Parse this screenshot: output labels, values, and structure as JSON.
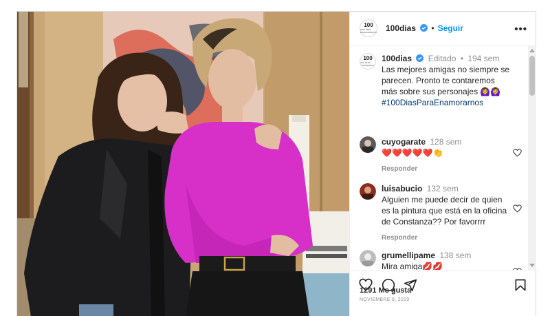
{
  "header": {
    "logo_text": "100",
    "logo_sub": "DÍAS PARA ENAMORARNOS",
    "username": "100dias",
    "separator": "•",
    "follow_label": "Seguir",
    "more_label": "•••"
  },
  "caption": {
    "username": "100dias",
    "edited": "Editado",
    "separator": "•",
    "age": "194 sem",
    "text": "Las mejores amigas no siempre se parecen. Pronto te contaremos más sobre sus personajes 🙆‍♀️🙆‍♀️",
    "hashtag": "#100DiasParaEnamorarnos"
  },
  "comments": [
    {
      "username": "cuyogarate",
      "age": "128 sem",
      "text": "❤️❤️❤️❤️❤️👏",
      "reply_label": "Responder"
    },
    {
      "username": "luisabucio",
      "age": "132 sem",
      "text": "Alguien me puede decir de quien es la pintura que está en la oficina de Constanza?? Por favorrrr",
      "reply_label": "Responder"
    },
    {
      "username": "grumellipame",
      "age": "138 sem",
      "text": "Mira amiga💋💋"
    }
  ],
  "footer": {
    "likes": "1291 Me gusta",
    "date": "NOVIEMBRE 8, 2019"
  },
  "icons": {
    "like": "heart-icon",
    "comment": "comment-icon",
    "share": "share-icon",
    "save": "bookmark-icon",
    "verified": "verified-badge-icon"
  },
  "colors": {
    "accent": "#0095f6",
    "hashtag": "#00376b",
    "verified": "#3897f0",
    "muted": "#8e8e8e"
  }
}
